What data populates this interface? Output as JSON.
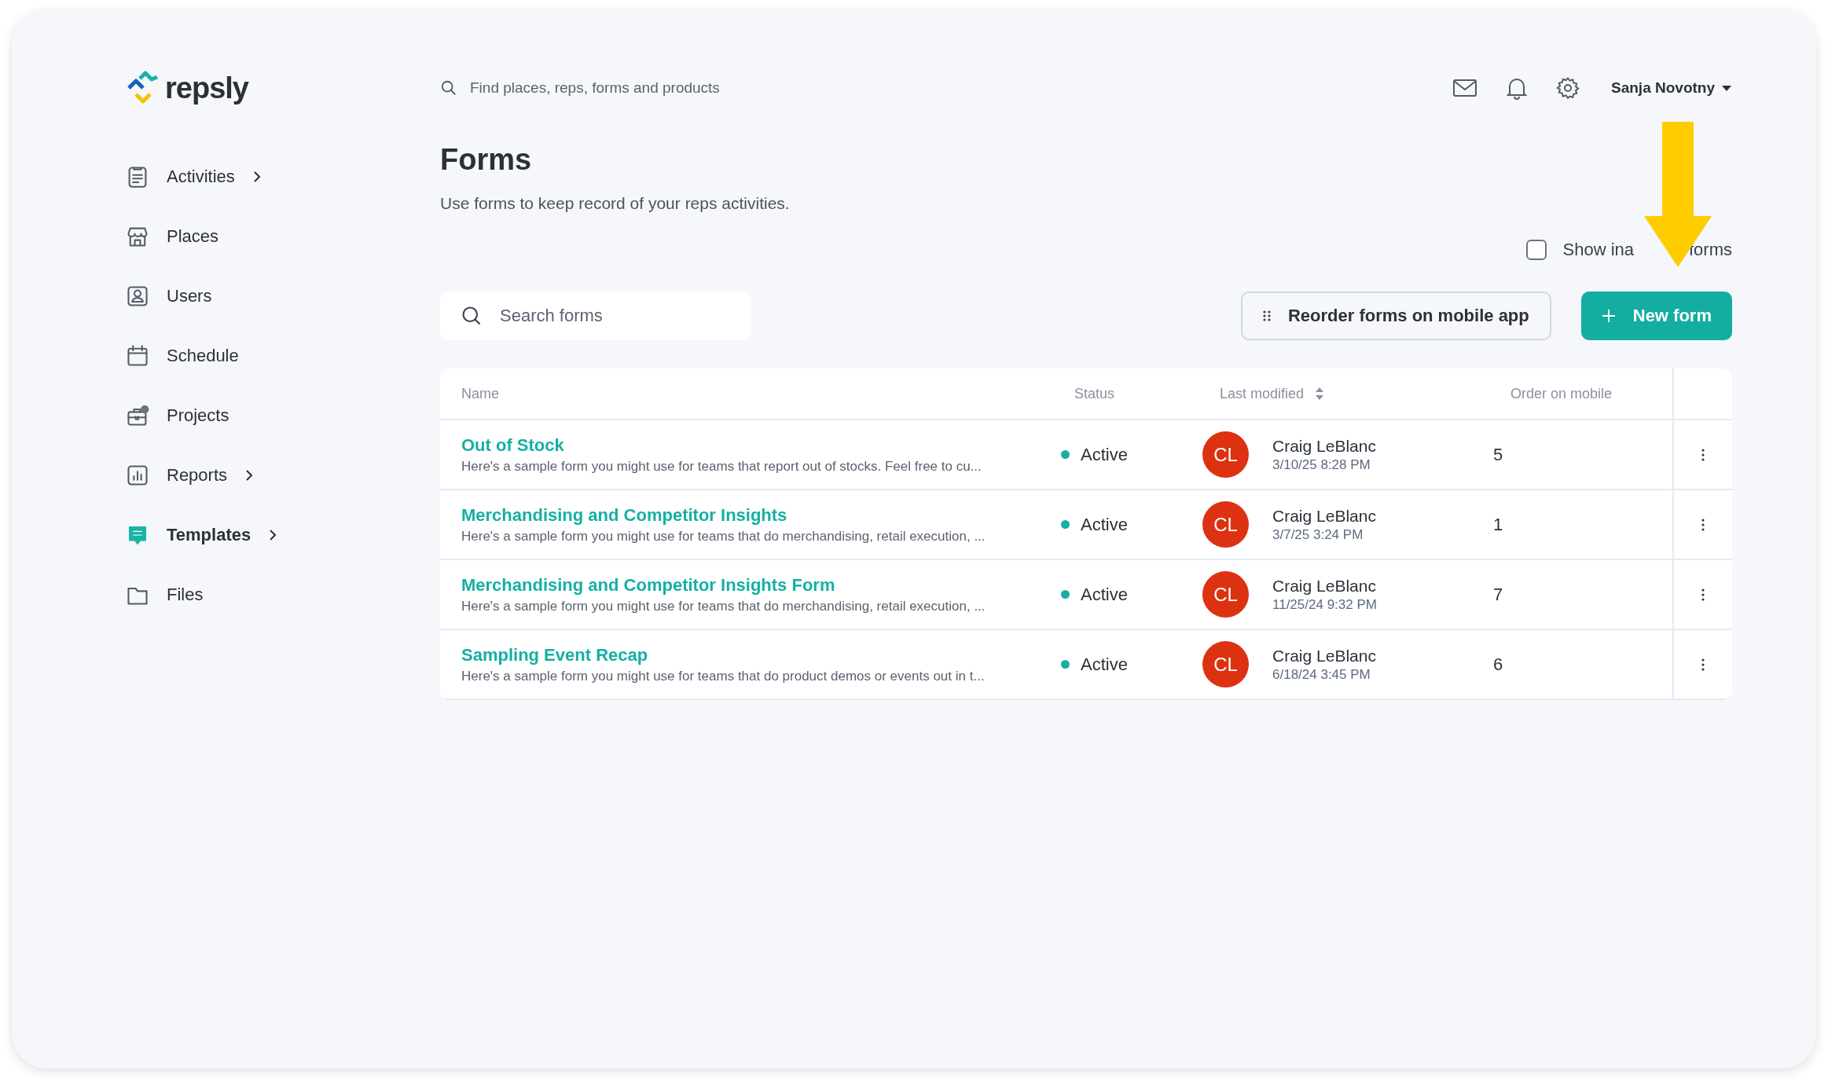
{
  "brand": {
    "name": "repsly"
  },
  "search": {
    "placeholder": "Find places, reps, forms and products"
  },
  "user": {
    "name": "Sanja Novotny"
  },
  "sidebar": {
    "items": [
      {
        "label": "Activities",
        "expandable": true,
        "selected": false
      },
      {
        "label": "Places",
        "expandable": false,
        "selected": false
      },
      {
        "label": "Users",
        "expandable": false,
        "selected": false
      },
      {
        "label": "Schedule",
        "expandable": false,
        "selected": false
      },
      {
        "label": "Projects",
        "expandable": false,
        "selected": false
      },
      {
        "label": "Reports",
        "expandable": true,
        "selected": false
      },
      {
        "label": "Templates",
        "expandable": true,
        "selected": true
      },
      {
        "label": "Files",
        "expandable": false,
        "selected": false
      }
    ]
  },
  "page": {
    "title": "Forms",
    "subtitle": "Use forms to keep record of your reps activities."
  },
  "show_inactive": {
    "label_parts": [
      "Show ina",
      "forms"
    ],
    "checked": false
  },
  "form_search": {
    "placeholder": "Search forms"
  },
  "buttons": {
    "reorder": "Reorder forms on mobile app",
    "new": "New form"
  },
  "table": {
    "columns": [
      "Name",
      "Status",
      "Last modified",
      "Order on mobile"
    ],
    "rows": [
      {
        "name": "Out of Stock",
        "description": "Here's a sample form you might use for teams that report out of stocks. Feel free to cu...",
        "status": "Active",
        "initials": "CL",
        "modified_by": "Craig LeBlanc",
        "modified_at": "3/10/25 8:28 PM",
        "order": "5"
      },
      {
        "name": "Merchandising and Competitor Insights",
        "description": "Here's a sample form you might use for teams that do merchandising, retail execution, ...",
        "status": "Active",
        "initials": "CL",
        "modified_by": "Craig LeBlanc",
        "modified_at": "3/7/25 3:24 PM",
        "order": "1"
      },
      {
        "name": "Merchandising and Competitor Insights Form",
        "description": "Here's a sample form you might use for teams that do merchandising, retail execution, ...",
        "status": "Active",
        "initials": "CL",
        "modified_by": "Craig LeBlanc",
        "modified_at": "11/25/24 9:32 PM",
        "order": "7"
      },
      {
        "name": "Sampling Event Recap",
        "description": "Here's a sample form you might use for teams that do product demos or events out in t...",
        "status": "Active",
        "initials": "CL",
        "modified_by": "Craig LeBlanc",
        "modified_at": "6/18/24 3:45 PM",
        "order": "6"
      }
    ]
  }
}
